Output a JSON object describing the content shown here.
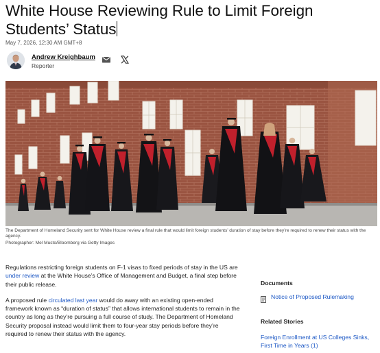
{
  "article": {
    "headline": "White House Reviewing Rule to Limit Foreign Students’ Status",
    "timestamp": "May 7, 2026, 12:30 AM GMT+8",
    "author": {
      "name": "Andrew Kreighbaum",
      "role": "Reporter"
    },
    "share": {
      "email_icon": "mail-icon",
      "x_icon": "x-logo-icon"
    },
    "image": {
      "caption": "The Department of Homeland Security sent for White House review a final rule that would limit foreign students’ duration of stay before they’re required to renew their status with the agency.",
      "credit": "Photographer: Mel Musto/Bloomberg via Getty Images"
    },
    "body": {
      "p1_before": "Regulations restricting foreign students on F-1 visas to fixed periods of stay in the US are ",
      "p1_link": "under review",
      "p1_after": " at the White House’s Office of Management and Budget, a final step before their public release.",
      "p2_before": "A proposed rule ",
      "p2_link": "circulated last year",
      "p2_after": " would do away with an existing open-ended framework known as “duration of status” that allows international students to remain in the country as long as they’re pursuing a full course of study. The Department of Homeland Security proposal instead would limit them to four-year stay periods before they’re required to renew their status with the agency."
    }
  },
  "sidebar": {
    "documents_heading": "Documents",
    "documents": [
      {
        "label": "Notice of Proposed Rulemaking",
        "icon": "document-icon"
      }
    ],
    "related_heading": "Related Stories",
    "related": [
      {
        "label": "Foreign Enrollment at US Colleges Sinks, First Time in Years (1)"
      }
    ]
  },
  "colors": {
    "link": "#1a56c4",
    "text": "#222222",
    "brick": "#a25b45",
    "sash": "#c0202c"
  }
}
